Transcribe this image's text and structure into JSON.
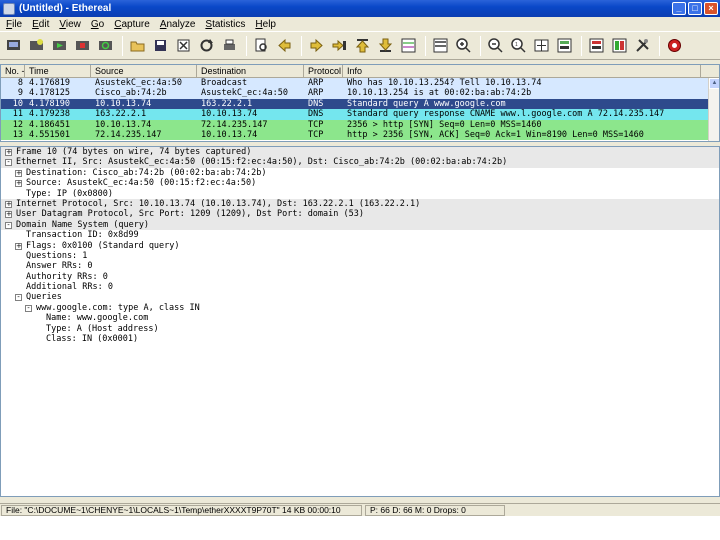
{
  "window": {
    "title": "(Untitled) - Ethereal",
    "minimize": "_",
    "maximize": "□",
    "close": "×"
  },
  "menu": [
    "File",
    "Edit",
    "View",
    "Go",
    "Capture",
    "Analyze",
    "Statistics",
    "Help"
  ],
  "toolbar_icons": [
    "interfaces-icon",
    "options-icon",
    "start-icon",
    "stop-icon",
    "restart-icon",
    "open-icon",
    "save-icon",
    "close-file-icon",
    "reload-icon",
    "print-icon",
    "find-icon",
    "back-icon",
    "forward-icon",
    "goto-icon",
    "first-icon",
    "last-icon",
    "colorize-icon",
    "autoscroll-icon",
    "zoom-in-icon",
    "zoom-out-icon",
    "zoom-normal-icon",
    "resize-columns-icon",
    "capture-filter-icon",
    "display-filter-icon",
    "coloring-rules-icon",
    "preferences-icon",
    "help-icon"
  ],
  "packet_list": {
    "columns": [
      "No. -",
      "Time",
      "Source",
      "Destination",
      "Protocol",
      "Info"
    ],
    "rows": [
      {
        "no": "8",
        "time": "4.176819",
        "src": "AsustekC_ec:4a:50",
        "dst": "Broadcast",
        "proto": "ARP",
        "info": "Who has 10.10.13.254?  Tell 10.10.13.74",
        "bg": "#d6e8ff",
        "fg": "#000000"
      },
      {
        "no": "9",
        "time": "4.178125",
        "src": "Cisco_ab:74:2b",
        "dst": "AsustekC_ec:4a:50",
        "proto": "ARP",
        "info": "10.10.13.254 is at 00:02:ba:ab:74:2b",
        "bg": "#d6e8ff",
        "fg": "#000000"
      },
      {
        "no": "10",
        "time": "4.178190",
        "src": "10.10.13.74",
        "dst": "163.22.2.1",
        "proto": "DNS",
        "info": "Standard query A www.google.com",
        "bg": "#2e4a8c",
        "fg": "#ffffff"
      },
      {
        "no": "11",
        "time": "4.179238",
        "src": "163.22.2.1",
        "dst": "10.10.13.74",
        "proto": "DNS",
        "info": "Standard query response CNAME www.l.google.com A 72.14.235.147",
        "bg": "#74e6ee",
        "fg": "#000000"
      },
      {
        "no": "12",
        "time": "4.186451",
        "src": "10.10.13.74",
        "dst": "72.14.235.147",
        "proto": "TCP",
        "info": "2356 > http [SYN] Seq=0 Len=0 MSS=1460",
        "bg": "#8ce68c",
        "fg": "#000000"
      },
      {
        "no": "13",
        "time": "4.551501",
        "src": "72.14.235.147",
        "dst": "10.10.13.74",
        "proto": "TCP",
        "info": "http > 2356 [SYN, ACK] Seq=0 Ack=1 Win=8190 Len=0 MSS=1460",
        "bg": "#8ce68c",
        "fg": "#000000"
      }
    ]
  },
  "detail_tree": [
    {
      "level": 0,
      "expander": "+",
      "text": "Frame 10 (74 bytes on wire, 74 bytes captured)",
      "top": true
    },
    {
      "level": 0,
      "expander": "-",
      "text": "Ethernet II, Src: AsustekC_ec:4a:50 (00:15:f2:ec:4a:50), Dst: Cisco_ab:74:2b (00:02:ba:ab:74:2b)",
      "top": true
    },
    {
      "level": 1,
      "expander": "+",
      "text": "Destination: Cisco_ab:74:2b (00:02:ba:ab:74:2b)",
      "top": false
    },
    {
      "level": 1,
      "expander": "+",
      "text": "Source: AsustekC_ec:4a:50 (00:15:f2:ec:4a:50)",
      "top": false
    },
    {
      "level": 1,
      "expander": "",
      "text": "Type: IP (0x0800)",
      "top": false
    },
    {
      "level": 0,
      "expander": "+",
      "text": "Internet Protocol, Src: 10.10.13.74 (10.10.13.74), Dst: 163.22.2.1 (163.22.2.1)",
      "top": true
    },
    {
      "level": 0,
      "expander": "+",
      "text": "User Datagram Protocol, Src Port: 1209 (1209), Dst Port: domain (53)",
      "top": true
    },
    {
      "level": 0,
      "expander": "-",
      "text": "Domain Name System (query)",
      "top": true
    },
    {
      "level": 1,
      "expander": "",
      "text": "Transaction ID: 0x8d99",
      "top": false
    },
    {
      "level": 1,
      "expander": "+",
      "text": "Flags: 0x0100 (Standard query)",
      "top": false
    },
    {
      "level": 1,
      "expander": "",
      "text": "Questions: 1",
      "top": false
    },
    {
      "level": 1,
      "expander": "",
      "text": "Answer RRs: 0",
      "top": false
    },
    {
      "level": 1,
      "expander": "",
      "text": "Authority RRs: 0",
      "top": false
    },
    {
      "level": 1,
      "expander": "",
      "text": "Additional RRs: 0",
      "top": false
    },
    {
      "level": 1,
      "expander": "-",
      "text": "Queries",
      "top": false
    },
    {
      "level": 2,
      "expander": "-",
      "text": "www.google.com: type A, class IN",
      "top": false
    },
    {
      "level": 3,
      "expander": "",
      "text": "Name: www.google.com",
      "top": false
    },
    {
      "level": 3,
      "expander": "",
      "text": "Type: A (Host address)",
      "top": false
    },
    {
      "level": 3,
      "expander": "",
      "text": "Class: IN (0x0001)",
      "top": false
    }
  ],
  "status": {
    "file": "File: \"C:\\DOCUME~1\\CHENYE~1\\LOCALS~1\\Temp\\etherXXXXT9P70T\" 14 KB 00:00:10",
    "stats": "P: 66 D: 66 M: 0 Drops: 0"
  },
  "colors": {
    "selected": "#2e4a8c",
    "arp": "#d6e8ff",
    "dns": "#74e6ee",
    "tcp": "#8ce68c"
  }
}
